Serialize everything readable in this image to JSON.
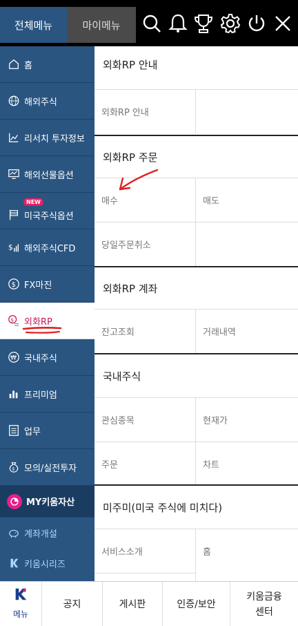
{
  "header": {
    "tab_all": "전체메뉴",
    "tab_my": "마이메뉴",
    "icons": [
      "search-icon",
      "bell-icon",
      "trophy-icon",
      "gear-icon",
      "power-icon",
      "close-icon"
    ]
  },
  "sidebar": {
    "items": [
      {
        "label": "홈",
        "icon": "home-icon"
      },
      {
        "label": "해외주식",
        "icon": "globe-icon"
      },
      {
        "label": "리서치 투자정보",
        "icon": "chart-icon"
      },
      {
        "label": "해외선물옵션",
        "icon": "monitor-chart-icon"
      },
      {
        "label": "미국주식옵션",
        "icon": "flag-icon",
        "badge": "NEW"
      },
      {
        "label": "해외주식CFD",
        "icon": "dollar-bars-icon"
      },
      {
        "label": "FX마진",
        "icon": "dollar-circle-icon"
      },
      {
        "label": "외화RP",
        "icon": "coin-icon",
        "active": true
      },
      {
        "label": "국내주식",
        "icon": "won-icon"
      },
      {
        "label": "프리미엄",
        "icon": "bars-icon"
      },
      {
        "label": "업무",
        "icon": "checklist-icon"
      },
      {
        "label": "모의/실전투자",
        "icon": "money-bag-icon"
      },
      {
        "label": "MY키움자산",
        "icon": "pie-icon"
      },
      {
        "label": "계좌개설",
        "icon": "piggy-icon"
      },
      {
        "label": "키움시리즈",
        "icon": "k-icon"
      }
    ]
  },
  "content": {
    "sections": [
      {
        "title": "외화RP 안내",
        "cells": [
          "외화RP 안내",
          ""
        ]
      },
      {
        "title": "외화RP 주문",
        "cells": [
          "매수",
          "매도",
          "당일주문취소",
          ""
        ]
      },
      {
        "title": "외화RP 계좌",
        "cells": [
          "잔고조회",
          "거래내역"
        ]
      },
      {
        "title": "국내주식",
        "cells": [
          "관심종목",
          "현재가",
          "주문",
          "차트"
        ]
      },
      {
        "title": "미주미(미국 주식에 미치다)",
        "cells": [
          "서비스소개",
          "홈"
        ]
      }
    ]
  },
  "bottom": {
    "menu_label": "메뉴",
    "items": [
      "공지",
      "게시판",
      "인증/보안",
      "키움금융\n센터"
    ]
  },
  "colors": {
    "sidebar_bg": "#2a5580",
    "active_text": "#c2185b",
    "annotation": "#e02020"
  }
}
